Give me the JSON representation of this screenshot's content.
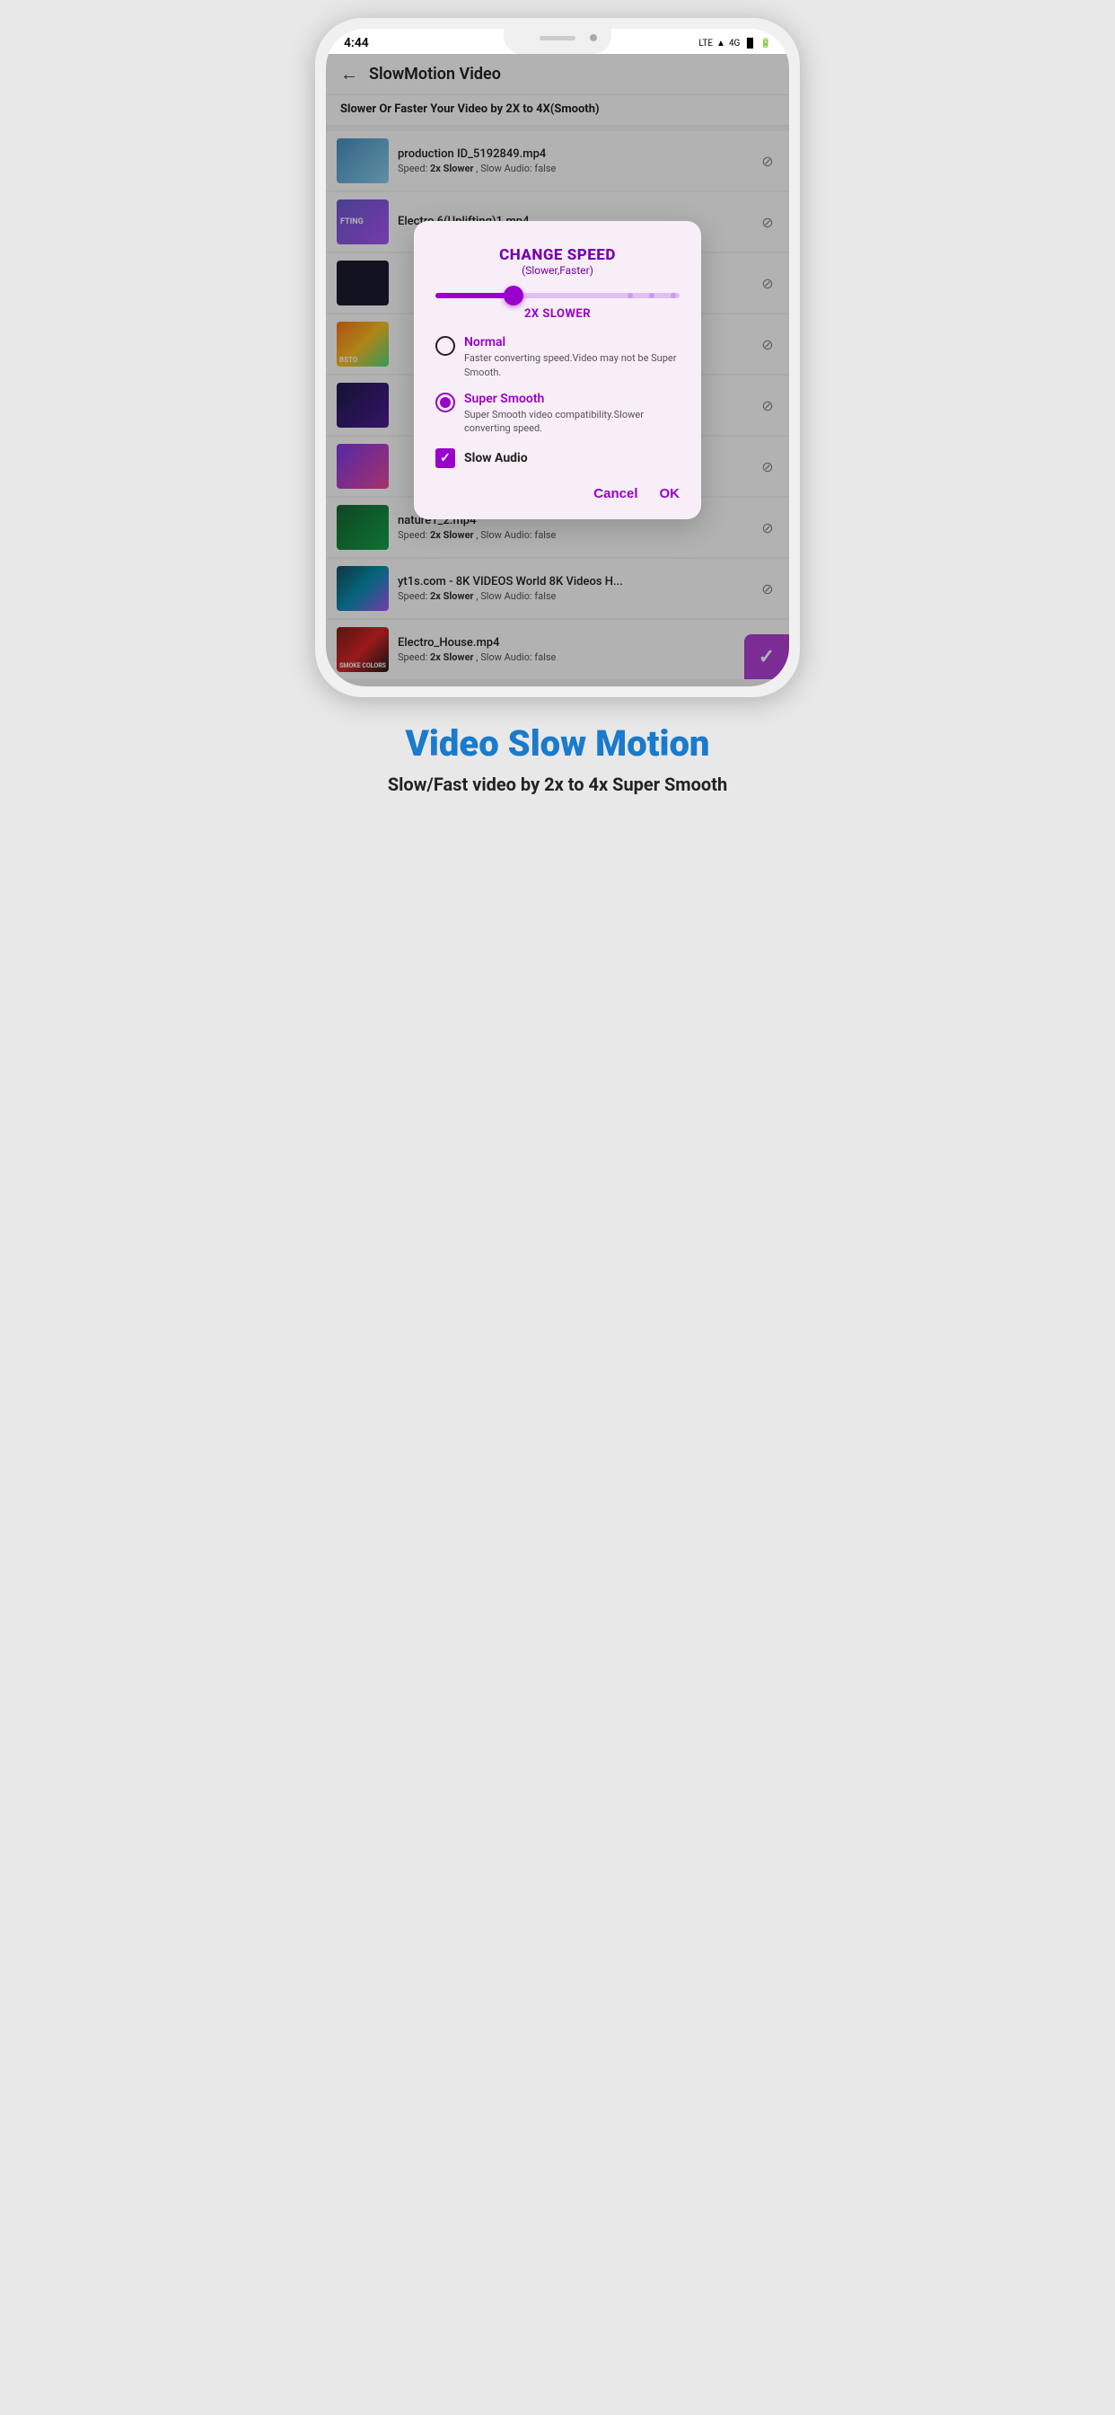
{
  "statusBar": {
    "time": "4:44",
    "icons": [
      "LTE",
      "wifi",
      "4G",
      "signal",
      "battery"
    ]
  },
  "toolbar": {
    "backLabel": "←",
    "title": "SlowMotion Video"
  },
  "subtitle": "Slower Or Faster Your Video by 2X to 4X(Smooth)",
  "videoList": [
    {
      "name": "production ID_5192849.mp4",
      "speed": "2x Slower",
      "slowAudio": "false",
      "thumbClass": "thumb-blue"
    },
    {
      "name": "Electro 6(Uplifting)1.mp4",
      "speed": "",
      "slowAudio": "",
      "thumbClass": "thumb-purple"
    },
    {
      "name": "",
      "speed": "",
      "slowAudio": "",
      "thumbClass": "thumb-dark"
    },
    {
      "name": "",
      "speed": "",
      "slowAudio": "",
      "thumbClass": "thumb-sunset"
    },
    {
      "name": "",
      "speed": "",
      "slowAudio": "",
      "thumbClass": "thumb-dark2"
    },
    {
      "name": "",
      "speed": "",
      "slowAudio": "",
      "thumbClass": "thumb-purple2"
    },
    {
      "name": "nature1_2.mp4",
      "speed": "2x Slower",
      "slowAudio": "false",
      "thumbClass": "thumb-nature"
    },
    {
      "name": "yt1s.com - 8K VIDEOS  World 8K Videos H...",
      "speed": "2x Slower",
      "slowAudio": "false",
      "thumbClass": "thumb-aurora"
    },
    {
      "name": "Electro_House.mp4",
      "speed": "2x Slower",
      "slowAudio": "false",
      "thumbClass": "thumb-smoke"
    }
  ],
  "dialog": {
    "title": "CHANGE SPEED",
    "subtitle": "(Slower,Faster)",
    "sliderValue": "2X SLOWER",
    "sliderFillPercent": 32,
    "normalOption": {
      "label": "Normal",
      "description": "Faster converting speed.Video may not be Super Smooth.",
      "selected": false
    },
    "superSmoothOption": {
      "label": "Super Smooth",
      "description": "Super Smooth video compatibility.Slower converting speed.",
      "selected": true
    },
    "slowAudioLabel": "Slow Audio",
    "slowAudioChecked": true,
    "cancelLabel": "Cancel",
    "okLabel": "OK"
  },
  "bottomSection": {
    "title": "Video Slow Motion",
    "tagline": "Slow/Fast video by 2x to 4x Super Smooth"
  }
}
